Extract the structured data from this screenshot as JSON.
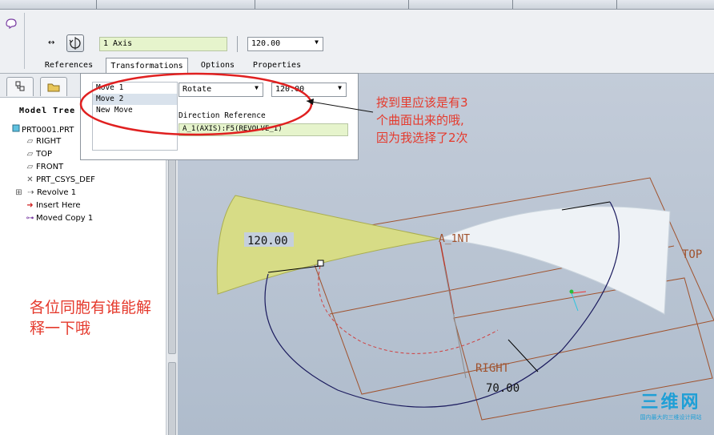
{
  "dashboard": {
    "axis_collector": "1 Axis",
    "angle_value": "120.00",
    "tabs": [
      "References",
      "Transformations",
      "Options",
      "Properties"
    ]
  },
  "transformations": {
    "moves": [
      "Move 1",
      "Move 2",
      "New Move"
    ],
    "selected_move": "Move 2",
    "move_type": "Rotate",
    "move_value": "120.00",
    "direction_reference_label": "Direction Reference",
    "direction_reference_value": "A_1(AXIS):F5(REVOLVE_1)"
  },
  "navigator": {
    "title": "Model Tree",
    "items": [
      {
        "label": "PRT0001.PRT",
        "icon": "part-icon"
      },
      {
        "label": "RIGHT",
        "icon": "datum-plane-icon"
      },
      {
        "label": "TOP",
        "icon": "datum-plane-icon"
      },
      {
        "label": "FRONT",
        "icon": "datum-plane-icon"
      },
      {
        "label": "PRT_CSYS_DEF",
        "icon": "csys-icon"
      },
      {
        "label": "Revolve 1",
        "icon": "revolve-icon"
      },
      {
        "label": "Insert Here",
        "icon": "insert-arrow-icon"
      },
      {
        "label": "Moved Copy 1",
        "icon": "moved-copy-icon"
      }
    ]
  },
  "graphics": {
    "dimension_top": "120.00",
    "dimension_bottom": "70.00",
    "axis_label": "A_1NT",
    "plane_label_top": "TOP",
    "plane_label_right": "RIGHT"
  },
  "annotations": {
    "right": [
      "按到里应该是有3",
      "个曲面出来的哦,",
      "因为我选择了2次"
    ],
    "left": [
      "各位同胞有谁能解",
      "释一下哦"
    ]
  },
  "watermark": {
    "title": "三维网",
    "subtitle": "国内最大的三维设计网站"
  },
  "colors": {
    "surface_fill": "#d7dc86",
    "annotation_red": "#e53a2d",
    "collector_green": "#e6f4cc",
    "datum_plane_brown": "#a0522d"
  }
}
